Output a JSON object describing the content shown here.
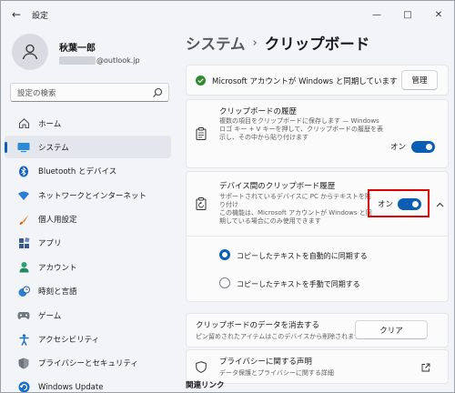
{
  "window": {
    "title": "設定",
    "back_icon": "←",
    "minimize": "—",
    "maximize": "□",
    "close": "✕"
  },
  "profile": {
    "name": "秋葉一郎",
    "email_suffix": "@outlook.jp"
  },
  "search": {
    "placeholder": "設定の検索"
  },
  "nav": {
    "items": [
      {
        "label": "ホーム",
        "icon": "home-icon"
      },
      {
        "label": "システム",
        "icon": "system-icon",
        "active": true
      },
      {
        "label": "Bluetooth とデバイス",
        "icon": "bluetooth-icon"
      },
      {
        "label": "ネットワークとインターネット",
        "icon": "wifi-icon"
      },
      {
        "label": "個人用設定",
        "icon": "brush-icon"
      },
      {
        "label": "アプリ",
        "icon": "apps-icon"
      },
      {
        "label": "アカウント",
        "icon": "account-icon"
      },
      {
        "label": "時刻と言語",
        "icon": "clock-globe-icon"
      },
      {
        "label": "ゲーム",
        "icon": "gamepad-icon"
      },
      {
        "label": "アクセシビリティ",
        "icon": "accessibility-icon"
      },
      {
        "label": "プライバシーとセキュリティ",
        "icon": "shield-icon"
      },
      {
        "label": "Windows Update",
        "icon": "update-icon"
      }
    ]
  },
  "main": {
    "breadcrumb_parent": "システム",
    "breadcrumb_sep": "›",
    "page_title": "クリップボード",
    "sync_banner": {
      "text": "Microsoft アカウントが Windows と同期しています",
      "button": "管理"
    },
    "history": {
      "title": "クリップボードの履歴",
      "desc": "複数の項目をクリップボードに保存します — Windows ロゴ キー + V キーを押して、クリップボードの履歴を表示し、その中から貼り付けます",
      "toggle_label": "オン",
      "toggle_on": true
    },
    "cross_device": {
      "title": "デバイス間のクリップボード履歴",
      "desc": "サポートされているデバイスに PC からテキストを貼り付け",
      "note": "この機能は、Microsoft アカウントが Windows と同期している場合にのみ使用できます",
      "toggle_label": "オン",
      "toggle_on": true,
      "options": [
        {
          "label": "コピーしたテキストを自動的に同期する",
          "checked": true
        },
        {
          "label": "コピーしたテキストを手動で同期する",
          "checked": false
        }
      ]
    },
    "clear": {
      "title": "クリップボードのデータを消去する",
      "desc": "ピン留めされたアイテムはこのデバイスから削除されません",
      "button": "クリア"
    },
    "privacy": {
      "title": "プライバシーに関する声明",
      "desc": "データ保護とプライバシーに関する詳細",
      "link_icon": "external-link-icon"
    },
    "related": "関連リンク"
  },
  "colors": {
    "accent": "#0a5fb4",
    "highlight_border": "#e00000",
    "check_green": "#2e8b2e"
  }
}
